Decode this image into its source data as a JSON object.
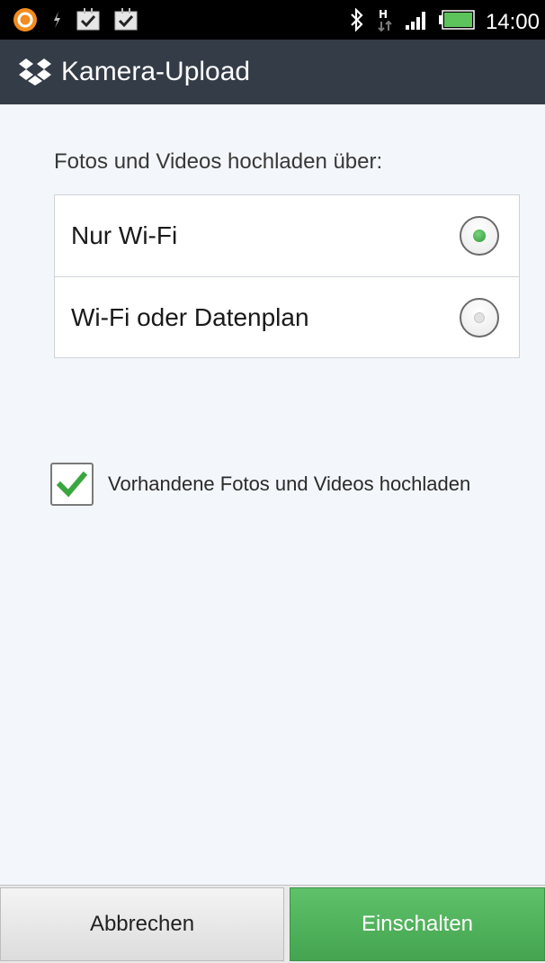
{
  "status_bar": {
    "time": "14:00",
    "network_type": "H",
    "icons_left": [
      "app-notification-icon",
      "usb-icon",
      "task-check-icon",
      "task-check-icon"
    ],
    "icons_right": [
      "bluetooth-icon",
      "network-h-icon",
      "signal-icon",
      "battery-icon"
    ]
  },
  "titlebar": {
    "title": "Kamera-Upload",
    "logo_icon": "dropbox-icon",
    "background": "#343c48"
  },
  "upload_section": {
    "label": "Fotos und Videos hochladen über:",
    "options": [
      {
        "label": "Nur Wi-Fi",
        "selected": true
      },
      {
        "label": "Wi-Fi oder Datenplan",
        "selected": false
      }
    ]
  },
  "existing_media": {
    "label": "Vorhandene Fotos und Videos hochladen",
    "checked": true,
    "check_color": "#3aa63f"
  },
  "buttons": {
    "cancel": "Abbrechen",
    "enable": "Einschalten",
    "enable_color": "#4cae57"
  }
}
